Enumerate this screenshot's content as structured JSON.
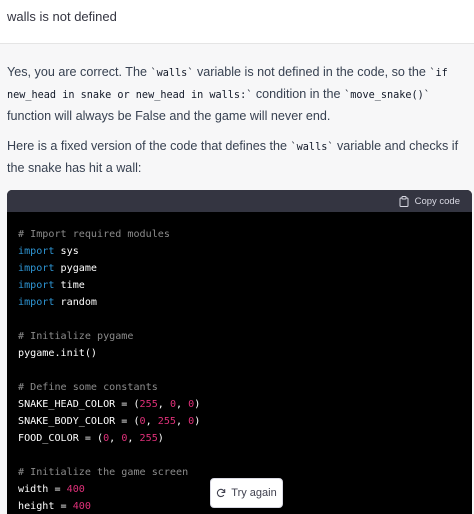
{
  "user_message": {
    "text": "walls is not defined"
  },
  "assistant": {
    "para1": {
      "t1": "Yes, you are correct. The ",
      "c1": "`walls`",
      "t2": " variable is not defined in the code, so the ",
      "c2": "`if new_head in snake or new_head in walls:`",
      "t3": " condition in the ",
      "c3": "`move_snake()`",
      "t4": " function will always be False and the game will never end."
    },
    "para2": {
      "t1": "Here is a fixed version of the code that defines the ",
      "c1": "`walls`",
      "t2": " variable and checks if the snake has hit a wall:"
    }
  },
  "code_block": {
    "copy_label": "Copy code",
    "lines": {
      "l0": "# Import required modules",
      "l1_kw": "import",
      "l1_mod": " sys",
      "l2_kw": "import",
      "l2_mod": " pygame",
      "l3_kw": "import",
      "l3_mod": " time",
      "l4_kw": "import",
      "l4_mod": " random",
      "l6": "# Initialize pygame",
      "l7": "pygame.init()",
      "l9": "# Define some constants",
      "l10": {
        "name": "SNAKE_HEAD_COLOR = (",
        "n1": "255",
        "s1": ", ",
        "n2": "0",
        "s2": ", ",
        "n3": "0",
        "end": ")"
      },
      "l11": {
        "name": "SNAKE_BODY_COLOR = (",
        "n1": "0",
        "s1": ", ",
        "n2": "255",
        "s2": ", ",
        "n3": "0",
        "end": ")"
      },
      "l12": {
        "name": "FOOD_COLOR = (",
        "n1": "0",
        "s1": ", ",
        "n2": "0",
        "s2": ", ",
        "n3": "255",
        "end": ")"
      },
      "l14": "# Initialize the game screen",
      "l15": {
        "name": "width = ",
        "n": "400"
      },
      "l16": {
        "name": "height = ",
        "n": "400"
      }
    }
  },
  "try_again_label": "Try again",
  "colors": {
    "code_bg": "#000000",
    "code_header_bg": "#343541",
    "keyword": "#2e95d3",
    "number": "#df3079",
    "comment": "#8b8b8b"
  }
}
